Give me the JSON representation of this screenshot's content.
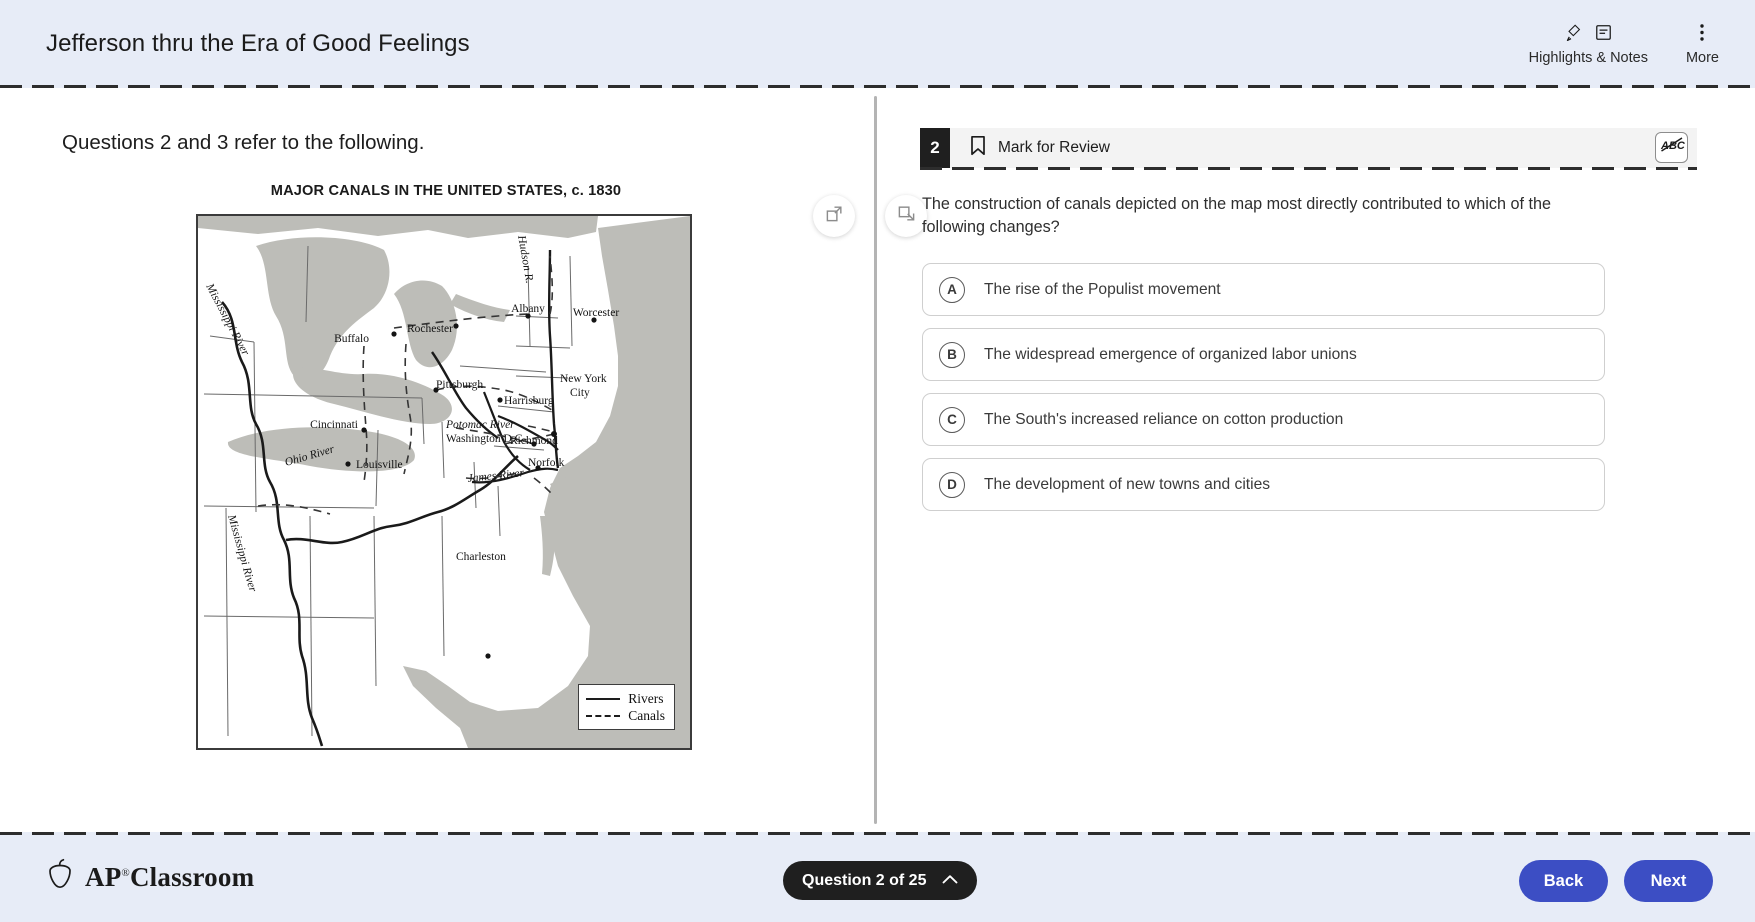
{
  "header": {
    "title": "Jefferson thru the Era of Good Feelings",
    "tools": [
      {
        "label": "Highlights & Notes",
        "icons": [
          "highlighter-icon",
          "note-icon"
        ]
      },
      {
        "label": "More",
        "icons": [
          "more-vertical-icon"
        ]
      }
    ]
  },
  "stimulus": {
    "intro": "Questions 2 and 3 refer to the following.",
    "map": {
      "title": "MAJOR CANALS IN THE UNITED STATES, c. 1830",
      "legend": [
        {
          "style": "solid",
          "label": "Rivers"
        },
        {
          "style": "dashed",
          "label": "Canals"
        }
      ],
      "cities": [
        "Buffalo",
        "Rochester",
        "Albany",
        "Worcester",
        "New York City",
        "Harrisburg",
        "Pittsburgh",
        "Cincinnati",
        "Louisville",
        "Washington D.C.",
        "Richmond",
        "Norfolk",
        "Charleston"
      ],
      "waterways": [
        "Mississippi River",
        "Hudson R.",
        "Ohio River",
        "Potomac River",
        "James River"
      ]
    }
  },
  "question": {
    "number": "2",
    "mark_for_review": "Mark for Review",
    "eliminate_tool": "ABC",
    "stem": "The construction of canals depicted on the map most directly contributed to which of the following changes?",
    "choices": [
      {
        "letter": "A",
        "text": "The rise of the Populist movement"
      },
      {
        "letter": "B",
        "text": "The widespread emergence of organized labor unions"
      },
      {
        "letter": "C",
        "text": "The South's increased reliance on cotton production"
      },
      {
        "letter": "D",
        "text": "The development of new towns and cities"
      }
    ]
  },
  "footer": {
    "brand": "AP",
    "brand_suffix": "Classroom",
    "question_nav": "Question 2 of 25",
    "back": "Back",
    "next": "Next"
  },
  "colors": {
    "header_bg": "#e7ecf7",
    "accent_blue": "#3c4ec4",
    "dark_pill": "#1f1f1f",
    "map_water": "#bdbdb8"
  }
}
